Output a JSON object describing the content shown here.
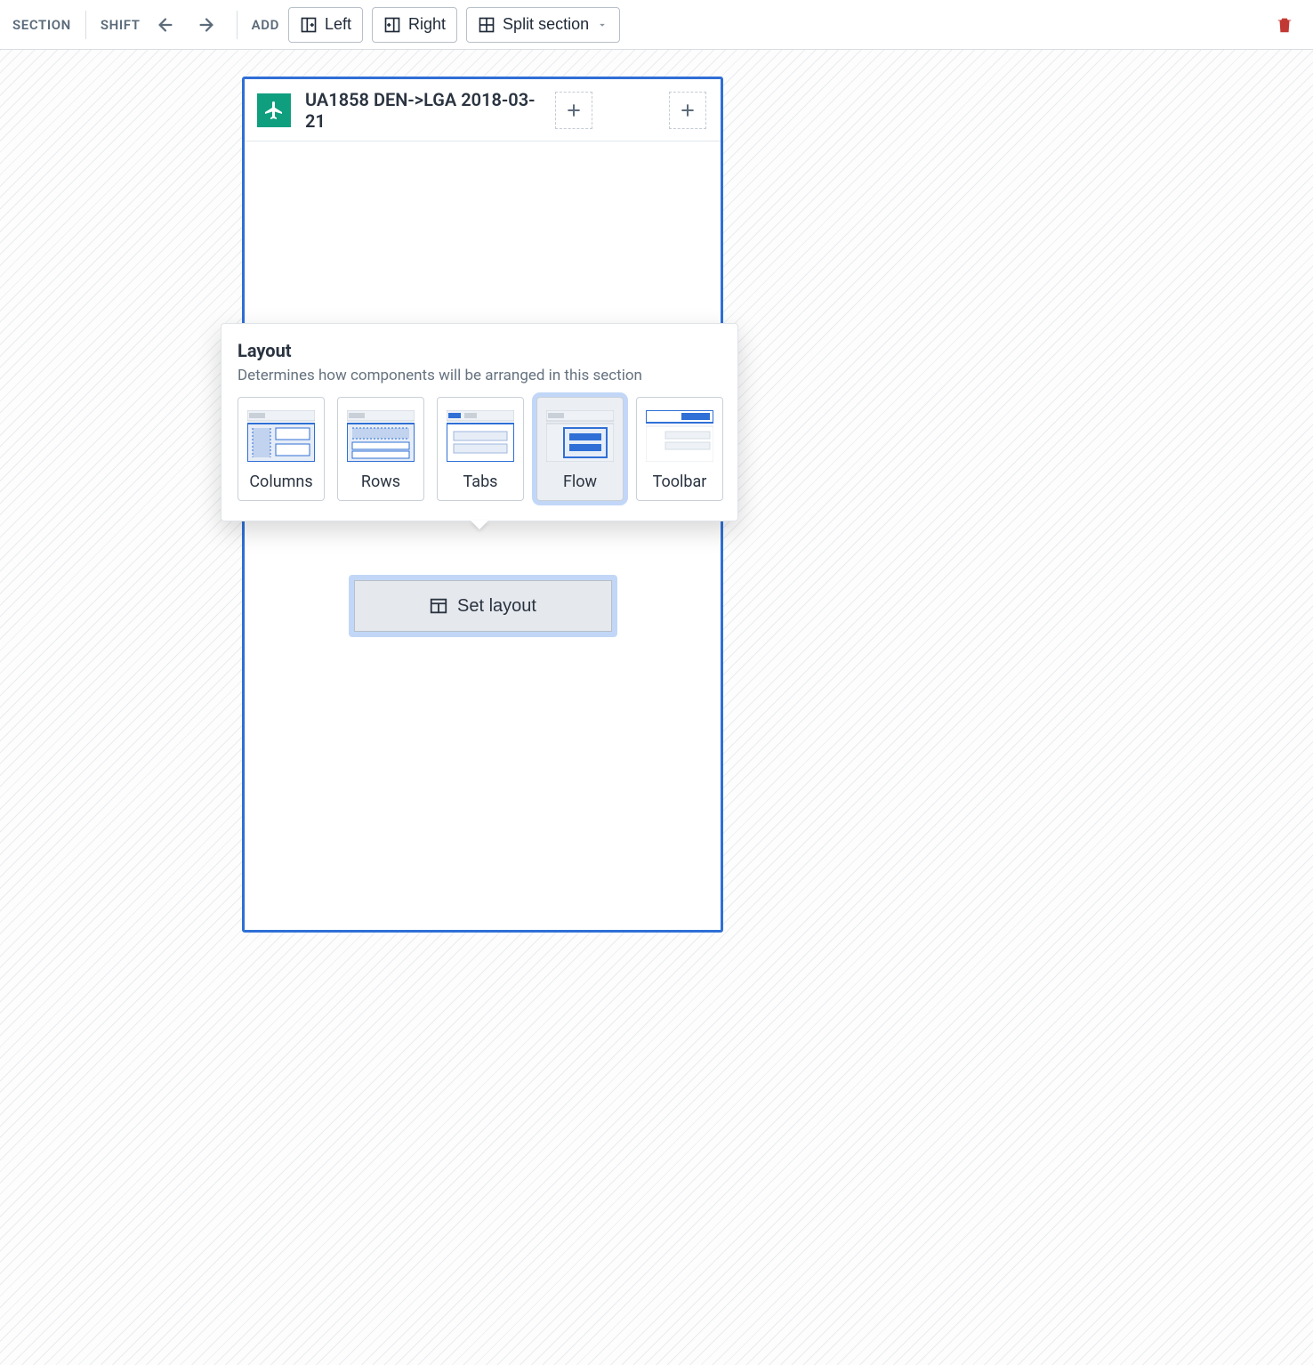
{
  "toolbar": {
    "section_label": "SECTION",
    "shift_label": "SHIFT",
    "add_label": "ADD",
    "left_button": "Left",
    "right_button": "Right",
    "split_button": "Split section"
  },
  "section": {
    "title": "UA1858 DEN->LGA 2018-03-21"
  },
  "popover": {
    "title": "Layout",
    "description": "Determines how components will be arranged in this section",
    "options": {
      "columns": "Columns",
      "rows": "Rows",
      "tabs": "Tabs",
      "flow": "Flow",
      "toolbar": "Toolbar"
    },
    "selected": "flow"
  },
  "set_layout": {
    "button_label": "Set layout"
  }
}
